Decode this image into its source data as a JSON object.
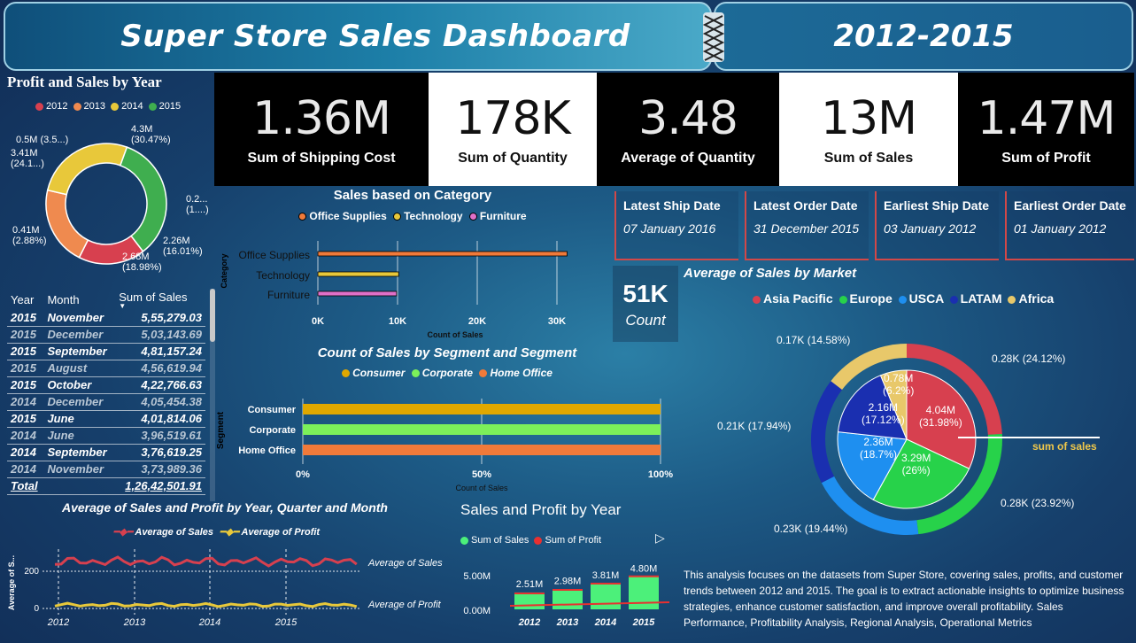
{
  "header": {
    "title": "Super Store Sales Dashboard",
    "years": "2012-2015"
  },
  "kpis": [
    {
      "value": "1.36M",
      "label": "Sum of Shipping Cost"
    },
    {
      "value": "178K",
      "label": "Sum of Quantity"
    },
    {
      "value": "3.48",
      "label": "Average of Quantity"
    },
    {
      "value": "13M",
      "label": "Sum of Sales"
    },
    {
      "value": "1.47M",
      "label": "Sum of Profit"
    }
  ],
  "dates": [
    {
      "label": "Latest Ship Date",
      "value": "07 January 2016"
    },
    {
      "label": "Latest Order Date",
      "value": "31 December 2015"
    },
    {
      "label": "Earliest Ship Date",
      "value": "03 January 2012"
    },
    {
      "label": "Earliest Order Date",
      "value": "01 January 2012"
    }
  ],
  "count_card": {
    "value": "51K",
    "label": "Count"
  },
  "profit_sales_by_year": {
    "title": "Profit and Sales by Year",
    "legend": [
      "2012",
      "2013",
      "2014",
      "2015"
    ],
    "labels": {
      "l_2015": "4.3M",
      "l_2015b": "(30.47%)",
      "l_2012a": "0.2...",
      "l_2012b": "(1....)",
      "l_2012c": "2.26M",
      "l_2012d": "(16.01%)",
      "l_2013a": "2.68M",
      "l_2013b": "(18.98%)",
      "l_s1": "0.41M",
      "l_s2": "(2.88%)",
      "l_2014a": "3.41M",
      "l_2014b": "(24.1...)",
      "l_top": "0.5M (3.5...)"
    }
  },
  "month_table": {
    "headers": [
      "Year",
      "Month",
      "Sum of Sales"
    ],
    "rows": [
      {
        "year": "2015",
        "month": "November",
        "sales": "5,55,279.03",
        "dim": false
      },
      {
        "year": "2015",
        "month": "December",
        "sales": "5,03,143.69",
        "dim": true
      },
      {
        "year": "2015",
        "month": "September",
        "sales": "4,81,157.24",
        "dim": false
      },
      {
        "year": "2015",
        "month": "August",
        "sales": "4,56,619.94",
        "dim": true
      },
      {
        "year": "2015",
        "month": "October",
        "sales": "4,22,766.63",
        "dim": false
      },
      {
        "year": "2014",
        "month": "December",
        "sales": "4,05,454.38",
        "dim": true
      },
      {
        "year": "2015",
        "month": "June",
        "sales": "4,01,814.06",
        "dim": false
      },
      {
        "year": "2014",
        "month": "June",
        "sales": "3,96,519.61",
        "dim": true
      },
      {
        "year": "2014",
        "month": "September",
        "sales": "3,76,619.25",
        "dim": false
      },
      {
        "year": "2014",
        "month": "November",
        "sales": "3,73,989.36",
        "dim": true
      }
    ],
    "total_label": "Total",
    "total_value": "1,26,42,501.91"
  },
  "category_chart": {
    "title": "Sales based on Category",
    "ylabel": "Category",
    "xlabel": "Count of Sales",
    "legend": [
      "Office Supplies",
      "Technology",
      "Furniture"
    ],
    "ticks": [
      "0K",
      "10K",
      "20K",
      "30K"
    ]
  },
  "segment_chart": {
    "title": "Count of Sales by Segment and Segment",
    "ylabel": "Segment",
    "xlabel": "Count of Sales",
    "legend": [
      "Consumer",
      "Corporate",
      "Home Office"
    ],
    "ticks": [
      "0%",
      "50%",
      "100%"
    ]
  },
  "market_chart": {
    "title": "Average of Sales by Market",
    "legend": [
      "Asia Pacific",
      "Europe",
      "USCA",
      "LATAM",
      "Africa"
    ],
    "outer_labels": [
      "0.28K (24.12%)",
      "0.28K (23.92%)",
      "0.23K (19.44%)",
      "0.21K (17.94%)",
      "0.17K (14.58%)"
    ],
    "inner_labels": {
      "a1": "4.04M",
      "a2": "(31.98%)",
      "e1": "3.29M",
      "e2": "(26%)",
      "u1": "2.36M",
      "u2": "(18.7%)",
      "l1": "2.16M",
      "l2": "(17.12%)",
      "f1": "0.78M",
      "f2": "(6.2%)"
    },
    "callout": "sum of sales"
  },
  "line_chart": {
    "title": "Average of Sales and Profit by Year, Quarter and Month",
    "legend": [
      "Average of Sales",
      "Average of Profit"
    ],
    "ylabel": "Average of S...",
    "yticks": [
      "200",
      "0"
    ],
    "xticks": [
      "2012",
      "2013",
      "2014",
      "2015"
    ],
    "end_labels": [
      "Average of Sales",
      "Average of Profit"
    ]
  },
  "year_chart": {
    "title": "Sales and Profit by Year",
    "legend": [
      "Sum of Sales",
      "Sum of Profit"
    ],
    "yticks": [
      "5.00M",
      "0.00M"
    ],
    "categories": [
      "2012",
      "2013",
      "2014",
      "2015"
    ],
    "bar_labels": [
      "2.51M",
      "2.98M",
      "3.81M",
      "4.80M"
    ]
  },
  "chart_data": [
    {
      "type": "pie",
      "title": "Profit and Sales by Year",
      "categories": [
        "2015",
        "2012",
        "2013",
        "2014"
      ],
      "values": [
        4.3,
        2.26,
        2.68,
        3.41
      ]
    },
    {
      "type": "bar",
      "title": "Sales based on Category",
      "categories": [
        "Office Supplies",
        "Technology",
        "Furniture"
      ],
      "values": [
        31273,
        10141,
        9876
      ],
      "xlim": [
        0,
        35000
      ]
    },
    {
      "type": "bar",
      "title": "Count of Sales by Segment and Segment",
      "categories": [
        "Consumer",
        "Corporate",
        "Home Office"
      ],
      "values": [
        100,
        100,
        100
      ]
    },
    {
      "type": "pie",
      "title": "Average of Sales by Market",
      "categories": [
        "Asia Pacific",
        "Europe",
        "USCA",
        "LATAM",
        "Africa"
      ],
      "values": [
        4.04,
        3.29,
        2.36,
        2.16,
        0.78
      ]
    },
    {
      "type": "bar",
      "title": "Sales and Profit by Year",
      "categories": [
        "2012",
        "2013",
        "2014",
        "2015"
      ],
      "series": [
        {
          "name": "Sum of Sales",
          "values": [
            2.51,
            2.98,
            3.81,
            4.8
          ]
        },
        {
          "name": "Sum of Profit",
          "values": [
            0.25,
            0.31,
            0.41,
            0.5
          ]
        }
      ]
    }
  ]
}
